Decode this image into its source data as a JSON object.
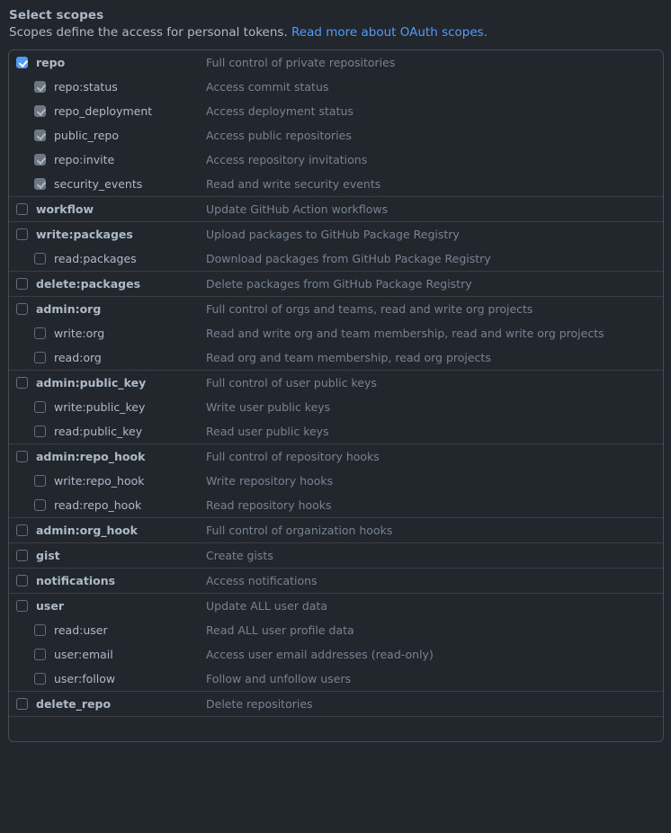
{
  "header": {
    "title": "Select scopes",
    "description_prefix": "Scopes define the access for personal tokens.",
    "link_text": "Read more about OAuth scopes."
  },
  "scope_groups": [
    {
      "items": [
        {
          "name": "repo",
          "description": "Full control of private repositories",
          "level": 0,
          "state": "checked"
        },
        {
          "name": "repo:status",
          "description": "Access commit status",
          "level": 1,
          "state": "disabled-checked"
        },
        {
          "name": "repo_deployment",
          "description": "Access deployment status",
          "level": 1,
          "state": "disabled-checked"
        },
        {
          "name": "public_repo",
          "description": "Access public repositories",
          "level": 1,
          "state": "disabled-checked"
        },
        {
          "name": "repo:invite",
          "description": "Access repository invitations",
          "level": 1,
          "state": "disabled-checked"
        },
        {
          "name": "security_events",
          "description": "Read and write security events",
          "level": 1,
          "state": "disabled-checked"
        }
      ]
    },
    {
      "items": [
        {
          "name": "workflow",
          "description": "Update GitHub Action workflows",
          "level": 0,
          "state": "unchecked"
        }
      ]
    },
    {
      "items": [
        {
          "name": "write:packages",
          "description": "Upload packages to GitHub Package Registry",
          "level": 0,
          "state": "unchecked"
        },
        {
          "name": "read:packages",
          "description": "Download packages from GitHub Package Registry",
          "level": 1,
          "state": "unchecked"
        }
      ]
    },
    {
      "items": [
        {
          "name": "delete:packages",
          "description": "Delete packages from GitHub Package Registry",
          "level": 0,
          "state": "unchecked"
        }
      ]
    },
    {
      "items": [
        {
          "name": "admin:org",
          "description": "Full control of orgs and teams, read and write org projects",
          "level": 0,
          "state": "unchecked"
        },
        {
          "name": "write:org",
          "description": "Read and write org and team membership, read and write org projects",
          "level": 1,
          "state": "unchecked"
        },
        {
          "name": "read:org",
          "description": "Read org and team membership, read org projects",
          "level": 1,
          "state": "unchecked"
        }
      ]
    },
    {
      "items": [
        {
          "name": "admin:public_key",
          "description": "Full control of user public keys",
          "level": 0,
          "state": "unchecked"
        },
        {
          "name": "write:public_key",
          "description": "Write user public keys",
          "level": 1,
          "state": "unchecked"
        },
        {
          "name": "read:public_key",
          "description": "Read user public keys",
          "level": 1,
          "state": "unchecked"
        }
      ]
    },
    {
      "items": [
        {
          "name": "admin:repo_hook",
          "description": "Full control of repository hooks",
          "level": 0,
          "state": "unchecked"
        },
        {
          "name": "write:repo_hook",
          "description": "Write repository hooks",
          "level": 1,
          "state": "unchecked"
        },
        {
          "name": "read:repo_hook",
          "description": "Read repository hooks",
          "level": 1,
          "state": "unchecked"
        }
      ]
    },
    {
      "items": [
        {
          "name": "admin:org_hook",
          "description": "Full control of organization hooks",
          "level": 0,
          "state": "unchecked"
        }
      ]
    },
    {
      "items": [
        {
          "name": "gist",
          "description": "Create gists",
          "level": 0,
          "state": "unchecked"
        }
      ]
    },
    {
      "items": [
        {
          "name": "notifications",
          "description": "Access notifications",
          "level": 0,
          "state": "unchecked"
        }
      ]
    },
    {
      "items": [
        {
          "name": "user",
          "description": "Update ALL user data",
          "level": 0,
          "state": "unchecked"
        },
        {
          "name": "read:user",
          "description": "Read ALL user profile data",
          "level": 1,
          "state": "unchecked"
        },
        {
          "name": "user:email",
          "description": "Access user email addresses (read-only)",
          "level": 1,
          "state": "unchecked"
        },
        {
          "name": "user:follow",
          "description": "Follow and unfollow users",
          "level": 1,
          "state": "unchecked"
        }
      ]
    },
    {
      "items": [
        {
          "name": "delete_repo",
          "description": "Delete repositories",
          "level": 0,
          "state": "unchecked"
        }
      ]
    },
    {
      "items": []
    }
  ],
  "colors": {
    "page_background": "#22272e",
    "panel_border": "#444c56",
    "separator": "#373e47",
    "scope_label": "#adbac7",
    "scope_description": "#768390",
    "link": "#539bf5",
    "checkbox_checked": "#539bf5",
    "checkbox_disabled": "#6e7681",
    "checkbox_border": "#636e7b"
  }
}
